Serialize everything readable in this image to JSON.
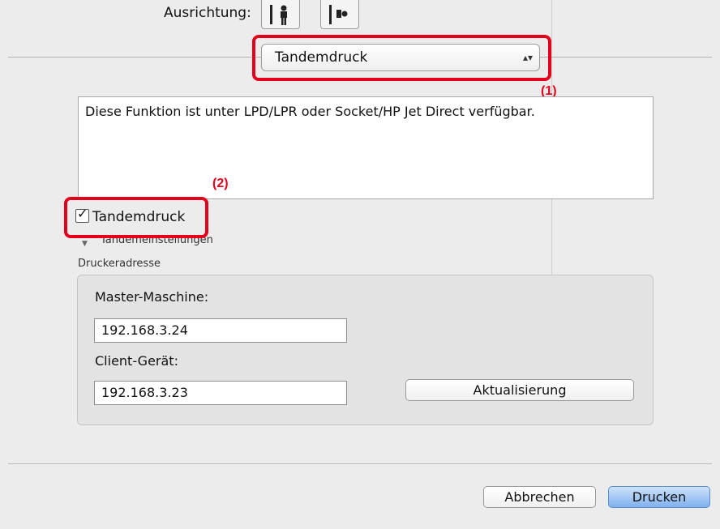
{
  "orientation": {
    "label": "Ausrichtung:",
    "icons": [
      "portrait-orientation-icon",
      "landscape-orientation-icon"
    ]
  },
  "popup": {
    "value": "Tandemdruck",
    "arrows": "▴▾"
  },
  "callouts": {
    "one": "(1)",
    "two": "(2)"
  },
  "info_text": "Diese Funktion ist unter  LPD/LPR oder Socket/HP Jet Direct verfügbar.",
  "tandem_checkbox": {
    "label": "Tandemdruck",
    "checked": true
  },
  "settings_label": "Tandemeinstellungen",
  "printer_address": {
    "group_label": "Druckeradresse",
    "master_label": "Master-Maschine:",
    "master_value": "192.168.3.24",
    "client_label": "Client-Gerät:",
    "client_value": "192.168.3.23",
    "refresh_button": "Aktualisierung"
  },
  "footer": {
    "cancel": "Abbrechen",
    "print": "Drucken"
  },
  "colors": {
    "callout_red": "#e4001c",
    "primary_button": "#7fb1ee"
  }
}
